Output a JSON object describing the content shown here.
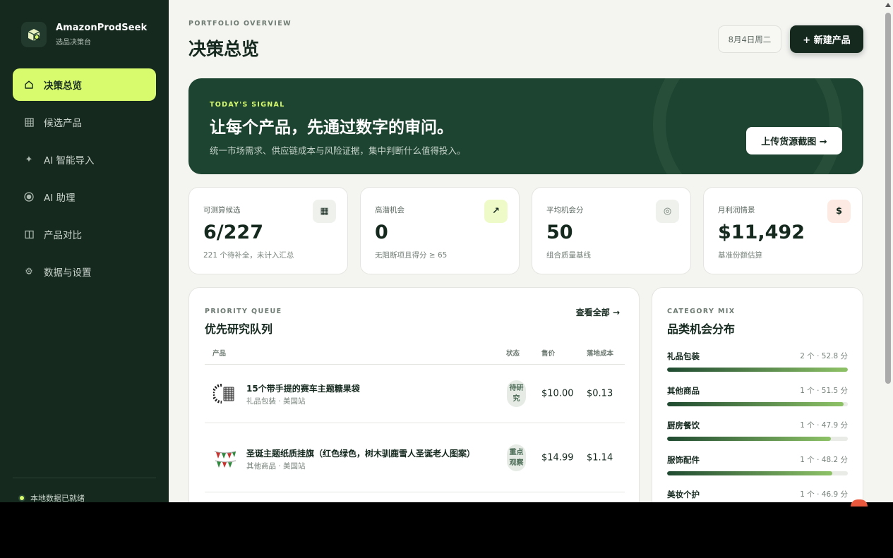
{
  "brand": {
    "name": "AmazonProdSeek",
    "subtitle": "选品决策台"
  },
  "nav": {
    "items": [
      {
        "label": "决策总览",
        "icon": "home-icon",
        "active": true
      },
      {
        "label": "候选产品",
        "icon": "grid-icon"
      },
      {
        "label": "AI 智能导入",
        "icon": "sparkle-icon"
      },
      {
        "label": "AI 助理",
        "icon": "radio-icon"
      },
      {
        "label": "产品对比",
        "icon": "columns-icon"
      },
      {
        "label": "数据与设置",
        "icon": "gear-icon"
      }
    ]
  },
  "status": {
    "text": "本地数据已就绪"
  },
  "header": {
    "eyebrow": "PORTFOLIO OVERVIEW",
    "title": "决策总览",
    "date": "8月4日周二",
    "new_button": "+ 新建产品"
  },
  "hero": {
    "eyebrow": "TODAY'S SIGNAL",
    "title": "让每个产品，先通过数字的审问。",
    "subtitle": "统一市场需求、供应链成本与风险证据，集中判断什么值得投入。",
    "button": "上传货源截图 →"
  },
  "stats": [
    {
      "label": "可测算候选",
      "value": "6/227",
      "note": "221 个待补全，未计入汇总",
      "icon": "▦",
      "icon_name": "table-icon",
      "icon_bg": "#eef1ec",
      "icon_color": "#15291f"
    },
    {
      "label": "高潜机会",
      "value": "0",
      "note": "无阻断项且得分 ≥ 65",
      "icon": "↗",
      "icon_name": "trend-up-icon",
      "icon_bg": "#eefbc8",
      "icon_color": "#15291f"
    },
    {
      "label": "平均机会分",
      "value": "50",
      "note": "组合质量基线",
      "icon": "◎",
      "icon_name": "target-icon",
      "icon_bg": "#eef1ec",
      "icon_color": "#6d7a72"
    },
    {
      "label": "月利润情景",
      "value": "$11,492",
      "note": "基准份额估算",
      "icon": "$",
      "icon_name": "dollar-icon",
      "icon_bg": "#fdebe3",
      "icon_color": "#15291f"
    }
  ],
  "queue": {
    "eyebrow": "PRIORITY QUEUE",
    "title": "优先研究队列",
    "view_all": "查看全部 →",
    "columns": {
      "product": "产品",
      "status": "状态",
      "price": "售价",
      "cost": "落地成本"
    },
    "rows": [
      {
        "name": "15个带手提的赛车主题糖果袋",
        "meta": "礼品包装 · 美国站",
        "status": "待研究",
        "price": "$10.00",
        "cost": "$0.13"
      },
      {
        "name": "圣诞主题纸质挂旗（红色绿色，树木驯鹿雪人圣诞老人图案）",
        "meta": "其他商品 · 美国站",
        "status": "重点观察",
        "price": "$14.99",
        "cost": "$1.14"
      }
    ]
  },
  "mix": {
    "eyebrow": "CATEGORY MIX",
    "title": "品类机会分布",
    "categories": [
      {
        "name": "礼品包装",
        "meta": "2 个 · 52.8 分",
        "share": 1.0
      },
      {
        "name": "其他商品",
        "meta": "1 个 · 51.5 分",
        "share": 0.975
      },
      {
        "name": "厨房餐饮",
        "meta": "1 个 · 47.9 分",
        "share": 0.907
      },
      {
        "name": "服饰配件",
        "meta": "1 个 · 48.2 分",
        "share": 0.913
      },
      {
        "name": "美妆个护",
        "meta": "1 个 · 46.9 分",
        "share": 0.888
      }
    ]
  },
  "colors": {
    "sidebar": "#15291f",
    "accent": "#d8fb6e",
    "hero": "#1d4430"
  }
}
